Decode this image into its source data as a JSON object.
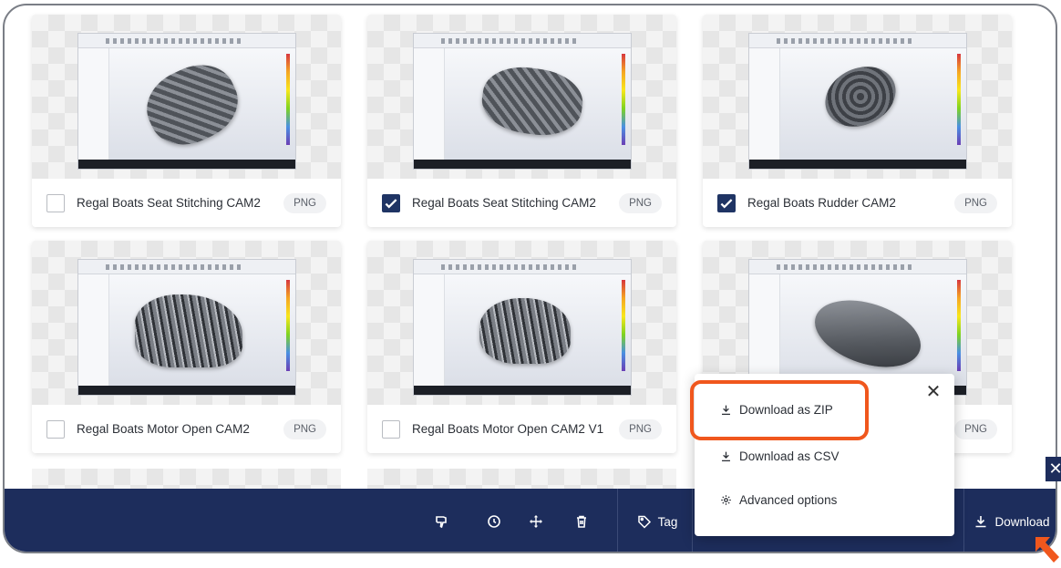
{
  "cards": [
    {
      "title": "Regal Boats Seat Stitching CAM2",
      "format": "PNG",
      "checked": false,
      "model": "m1"
    },
    {
      "title": "Regal Boats Seat Stitching CAM2",
      "format": "PNG",
      "checked": true,
      "model": "m2"
    },
    {
      "title": "Regal Boats Rudder CAM2",
      "format": "PNG",
      "checked": true,
      "model": "m3"
    },
    {
      "title": "Regal Boats Motor Open CAM2",
      "format": "PNG",
      "checked": false,
      "model": "m4"
    },
    {
      "title": "Regal Boats Motor Open CAM2 V1",
      "format": "PNG",
      "checked": false,
      "model": "m5"
    },
    {
      "title": "",
      "format": "PNG",
      "checked": false,
      "model": "m6"
    }
  ],
  "toolbar": {
    "icons": [
      "thumbs-down-icon",
      "clock-icon",
      "move-icon",
      "trash-icon"
    ],
    "tag_label": "Tag",
    "download_label": "Download",
    "close_symbol": "✕"
  },
  "download_menu": {
    "close_symbol": "✕",
    "items": [
      {
        "label": "Download as ZIP",
        "icon": "download-icon"
      },
      {
        "label": "Download as CSV",
        "icon": "download-icon"
      },
      {
        "label": "Advanced options",
        "icon": "gear-icon"
      }
    ]
  },
  "colors": {
    "toolbar_bg": "#1d2d5c",
    "checkbox_checked": "#1f3464",
    "highlight": "#f0571d"
  }
}
